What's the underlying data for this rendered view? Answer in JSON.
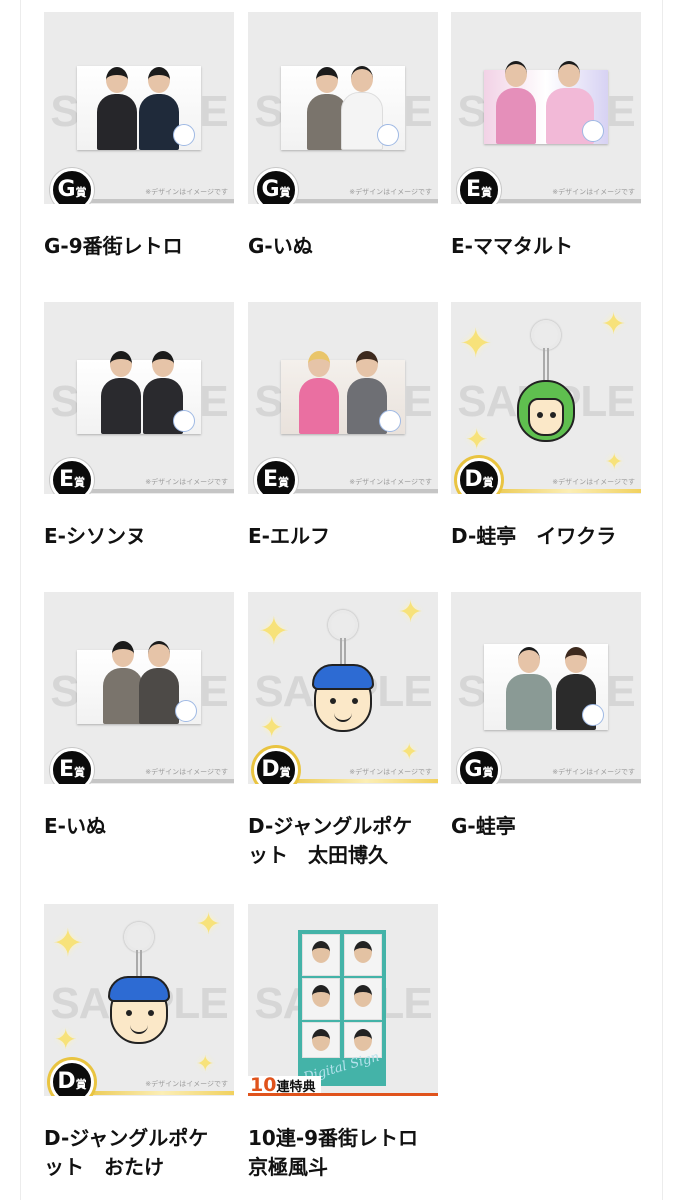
{
  "sample_watermark": "SAMPLE",
  "design_note": "※デザインはイメージです",
  "prizes": [
    {
      "caption": "G-9番街レトロ",
      "badge_letter": "G",
      "badge_kanji": "賞",
      "item": "photo",
      "tier": "gray"
    },
    {
      "caption": "G-いぬ",
      "badge_letter": "G",
      "badge_kanji": "賞",
      "item": "photo",
      "tier": "gray"
    },
    {
      "caption": "E-ママタルト",
      "badge_letter": "E",
      "badge_kanji": "賞",
      "item": "photo",
      "tier": "gray"
    },
    {
      "caption": "E-シソンヌ",
      "badge_letter": "E",
      "badge_kanji": "賞",
      "item": "photo",
      "tier": "gray"
    },
    {
      "caption": "E-エルフ",
      "badge_letter": "E",
      "badge_kanji": "賞",
      "item": "photo",
      "tier": "gray"
    },
    {
      "caption": "D-蛙亭　イワクラ",
      "badge_letter": "D",
      "badge_kanji": "賞",
      "item": "keychain",
      "tier": "gold"
    },
    {
      "caption": "E-いぬ",
      "badge_letter": "E",
      "badge_kanji": "賞",
      "item": "photo",
      "tier": "gray"
    },
    {
      "caption": "D-ジャングルポケ\nット　太田博久",
      "badge_letter": "D",
      "badge_kanji": "賞",
      "item": "keychain",
      "tier": "gold"
    },
    {
      "caption": "G-蛙亭",
      "badge_letter": "G",
      "badge_kanji": "賞",
      "item": "photo",
      "tier": "gray"
    },
    {
      "caption": "D-ジャングルポケ\nット　おたけ",
      "badge_letter": "D",
      "badge_kanji": "賞",
      "item": "keychain",
      "tier": "gold"
    },
    {
      "caption": "10連-9番街レトロ\n京極風斗",
      "bonus_number": "10",
      "bonus_label": "連特典",
      "item": "photo-collage",
      "tier": "bonus"
    }
  ],
  "collage_signature": "Digital Sign",
  "colors": {
    "thumb_bg": "#ebebeb",
    "gold": "#e9c441",
    "bonus_orange": "#e0531c",
    "badge_black": "#0b0b0b"
  }
}
